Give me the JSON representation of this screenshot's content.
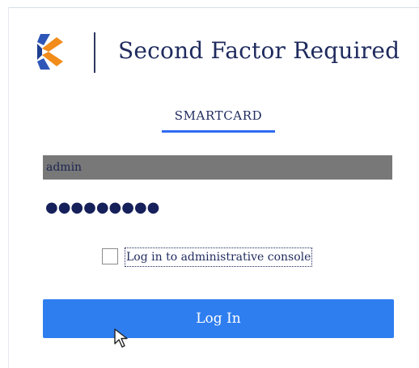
{
  "header": {
    "title": "Second Factor Required",
    "logo_icon": "logo-icon"
  },
  "tabs": [
    {
      "label": "SMARTCARD",
      "active": true
    }
  ],
  "form": {
    "username_value": "admin",
    "password_masked": "●●●●●●●●●",
    "admin_console_label": "Log in to administrative console",
    "admin_console_checked": false,
    "login_button_label": "Log In"
  },
  "colors": {
    "accent": "#2f7ef0",
    "title_text": "#1f2b5e",
    "tab_underline": "#2f6bf2",
    "username_bg": "#787878"
  }
}
